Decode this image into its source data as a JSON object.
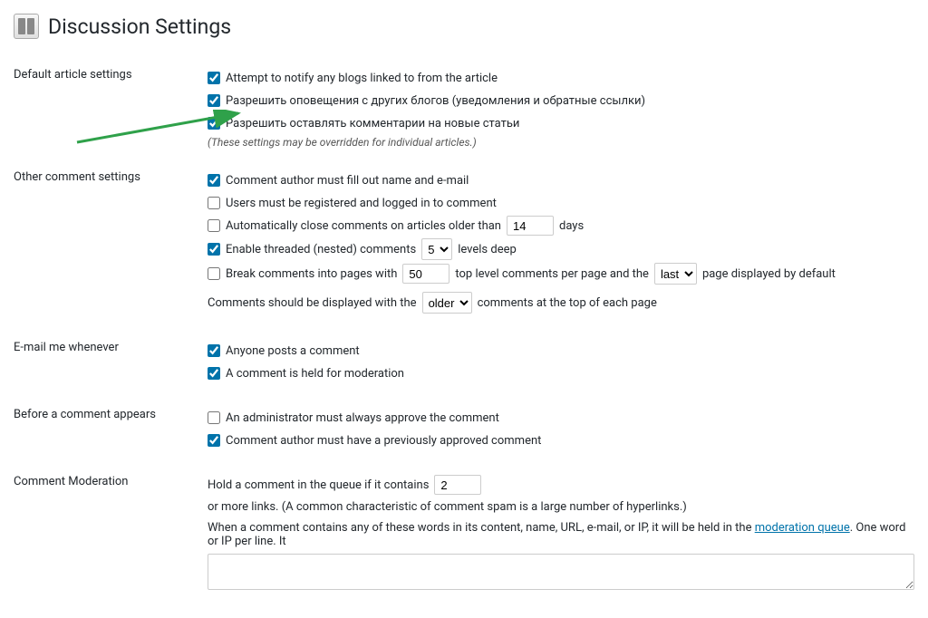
{
  "page": {
    "title": "Discussion Settings"
  },
  "section1": {
    "label": "Default article settings",
    "opt1": "Attempt to notify any blogs linked to from the article",
    "opt2": "Разрешить оповещения с других блогов (уведомления и обратные ссылки)",
    "opt3": "Разрешить оставлять комментарии на новые статьи",
    "note": "(These settings may be overridden for individual articles.)"
  },
  "section2": {
    "label": "Other comment settings",
    "opt1": "Comment author must fill out name and e-mail",
    "opt2": "Users must be registered and logged in to comment",
    "autoclose_pre": "Automatically close comments on articles older than",
    "autoclose_days": "14",
    "autoclose_post": "days",
    "threaded_pre": "Enable threaded (nested) comments",
    "threaded_level": "5",
    "threaded_post": "levels deep",
    "break_pre": "Break comments into pages with",
    "break_count": "50",
    "break_mid": "top level comments per page and the",
    "break_which": "last",
    "break_post": "page displayed by default",
    "order_pre": "Comments should be displayed with the",
    "order_which": "older",
    "order_post": "comments at the top of each page"
  },
  "section3": {
    "label": "E-mail me whenever",
    "opt1": "Anyone posts a comment",
    "opt2": "A comment is held for moderation"
  },
  "section4": {
    "label": "Before a comment appears",
    "opt1": "An administrator must always approve the comment",
    "opt2": "Comment author must have a previously approved comment"
  },
  "section5": {
    "label": "Comment Moderation",
    "hold_pre": "Hold a comment in the queue if it contains",
    "hold_count": "2",
    "hold_post": "or more links. (A common characteristic of comment spam is a large number of hyperlinks.)",
    "words_pre": "When a comment contains any of these words in its content, name, URL, e-mail, or IP, it will be held in the ",
    "words_link": "moderation queue",
    "words_post": ". One word or IP per line. It"
  },
  "arrow": {
    "color": "#2fa14a"
  }
}
